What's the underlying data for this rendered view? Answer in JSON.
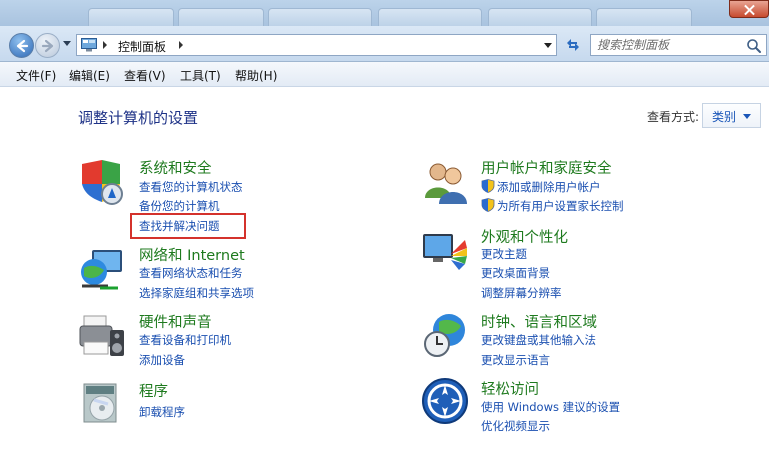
{
  "address": {
    "crumb": "控制面板",
    "search_placeholder": "搜索控制面板"
  },
  "menubar": [
    {
      "label": "文件(F)"
    },
    {
      "label": "编辑(E)"
    },
    {
      "label": "查看(V)"
    },
    {
      "label": "工具(T)"
    },
    {
      "label": "帮助(H)"
    }
  ],
  "header": {
    "title": "调整计算机的设置",
    "viewby_label": "查看方式:",
    "viewby_value": "类别"
  },
  "categories": [
    {
      "icon": "security-shield-icon",
      "title": "系统和安全",
      "links": [
        "查看您的计算机状态",
        "备份您的计算机",
        "查找并解决问题"
      ]
    },
    {
      "icon": "network-globe-icon",
      "title": "网络和 Internet",
      "links": [
        "查看网络状态和任务",
        "选择家庭组和共享选项"
      ]
    },
    {
      "icon": "printer-speaker-icon",
      "title": "硬件和声音",
      "links": [
        "查看设备和打印机",
        "添加设备"
      ]
    },
    {
      "icon": "programs-disc-icon",
      "title": "程序",
      "links": [
        "卸载程序"
      ]
    },
    {
      "icon": "users-icon",
      "title": "用户帐户和家庭安全",
      "links": [
        "添加或删除用户帐户",
        "为所有用户设置家长控制"
      ]
    },
    {
      "icon": "monitor-palette-icon",
      "title": "外观和个性化",
      "links": [
        "更改主题",
        "更改桌面背景",
        "调整屏幕分辨率"
      ]
    },
    {
      "icon": "clock-globe-icon",
      "title": "时钟、语言和区域",
      "links": [
        "更改键盘或其他输入法",
        "更改显示语言"
      ]
    },
    {
      "icon": "ease-of-access-icon",
      "title": "轻松访问",
      "links": [
        "使用 Windows 建议的设置",
        "优化视频显示"
      ]
    }
  ],
  "colors": {
    "category_title": "#1e7a1e",
    "link": "#1a4fb0",
    "highlight_box": "#d4322c"
  }
}
